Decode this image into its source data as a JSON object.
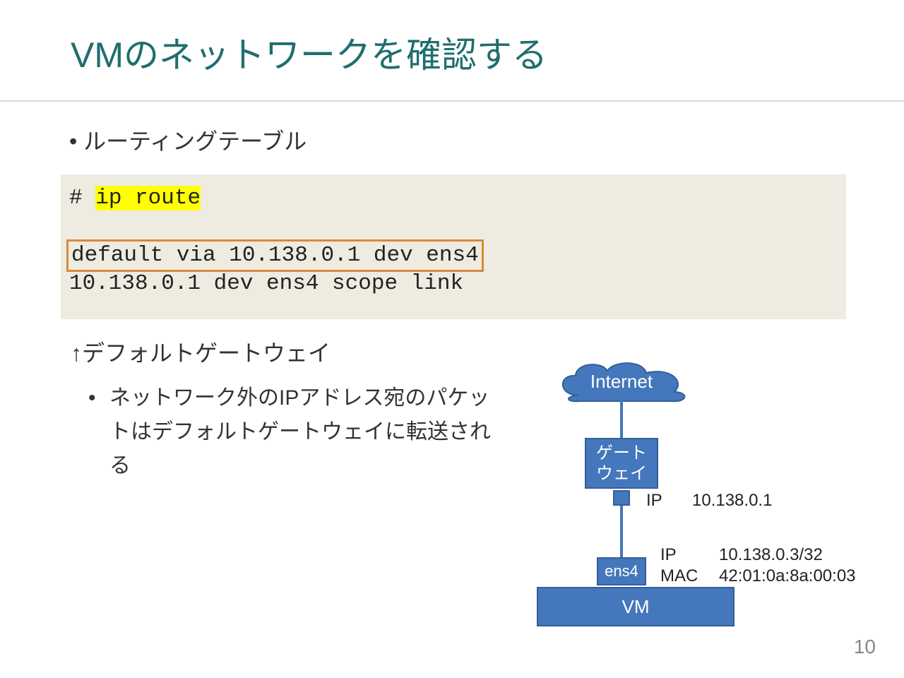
{
  "title": "VMのネットワークを確認する",
  "bullet_routing_table": "ルーティングテーブル",
  "code": {
    "prompt": "# ",
    "cmd": "ip route",
    "boxed_line": "default via 10.138.0.1 dev ens4",
    "line3": "10.138.0.1 dev ens4 scope link"
  },
  "note_arrow": "↑デフォルトゲートウェイ",
  "sub_bullet": "ネットワーク外のIPアドレス宛のパケットはデフォルトゲートウェイに転送される",
  "diagram": {
    "internet": "Internet",
    "gateway_line1": "ゲート",
    "gateway_line2": "ウェイ",
    "gw_ip_label": "IP",
    "gw_ip_value": "10.138.0.1",
    "ens_label": "ens4",
    "vm_ip_label": "IP",
    "vm_ip_value": "10.138.0.3/32",
    "vm_mac_label": "MAC",
    "vm_mac_value": "42:01:0a:8a:00:03",
    "vm_label": "VM"
  },
  "page_number": "10"
}
